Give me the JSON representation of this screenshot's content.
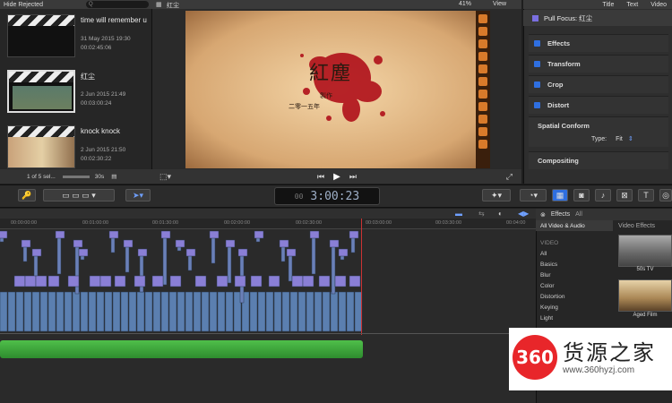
{
  "browser": {
    "filter_label": "Hide Rejected",
    "search_placeholder": "Q",
    "clips": [
      {
        "title": "time will remember u",
        "date": "31 May 2015 19:30",
        "duration": "00:02:45:06"
      },
      {
        "title": "红尘",
        "date": "2 Jun 2015 21:49",
        "duration": "00:03:00:24"
      },
      {
        "title": "knock knock",
        "date": "2 Jun 2015 21:50",
        "duration": "00:02:30:22"
      }
    ],
    "selection_count": "1 of 5 sel...",
    "duration_setting": "30s"
  },
  "viewer": {
    "clip_name": "红尘",
    "zoom": "41%",
    "view_label": "View",
    "frame_title": "紅塵",
    "frame_line1": "製作",
    "frame_line2": "二零一五年"
  },
  "inspector": {
    "tabs": [
      "Title",
      "Text",
      "Video"
    ],
    "header": "Pull Focus: 红尘",
    "sections": [
      "Effects",
      "Transform",
      "Crop",
      "Distort"
    ],
    "spatial_conform": "Spatial Conform",
    "type_label": "Type:",
    "type_value": "Fit",
    "compositing": "Compositing"
  },
  "toolbar": {
    "timecode": "3:00:23",
    "timecode_prefix": "00"
  },
  "timeline": {
    "ticks": [
      "00:00:00:00",
      "00:01:00:00",
      "00:01:30:00",
      "00:02:00:00",
      "00:02:30:00",
      "00:03:00:00",
      "00:03:30:00",
      "00:04:00"
    ]
  },
  "effects": {
    "header": "Effects",
    "filter": "All",
    "selected": "All Video & Audio",
    "category_title": "Video Effects",
    "group": "VIDEO",
    "categories": [
      "All",
      "Basics",
      "Blur",
      "Color",
      "Distortion",
      "Keying",
      "Light"
    ],
    "thumbs": [
      "50s TV",
      "Aged Film"
    ]
  },
  "watermark": {
    "logo": "360",
    "name": "货源之家",
    "url": "www.360hyzj.com"
  },
  "colors": {
    "accent": "#2f6fe0",
    "audio": "#3aa83a",
    "clip": "#5b7fb0",
    "title_clip": "#8a7fd6"
  }
}
